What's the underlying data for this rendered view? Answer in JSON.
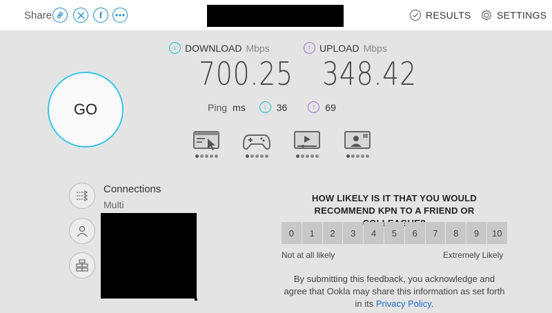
{
  "header": {
    "share_label": "Share",
    "share_buttons": [
      {
        "icon": "link-icon",
        "glyph": "⛓"
      },
      {
        "icon": "x-icon",
        "glyph": "𝕏"
      },
      {
        "icon": "facebook-icon",
        "glyph": "f"
      },
      {
        "icon": "more-icon",
        "glyph": "•••"
      }
    ],
    "results_label": "RESULTS",
    "settings_label": "SETTINGS"
  },
  "test": {
    "go_label": "GO",
    "download": {
      "label": "DOWNLOAD",
      "unit": "Mbps",
      "value": "700.25"
    },
    "upload": {
      "label": "UPLOAD",
      "unit": "Mbps",
      "value": "348.42"
    },
    "ping": {
      "label": "Ping",
      "unit": "ms",
      "download": "36",
      "upload": "69"
    },
    "use_cases": [
      "browsing-icon",
      "gaming-icon",
      "streaming-icon",
      "video-call-icon"
    ]
  },
  "connection": {
    "title": "Connections",
    "mode": "Multi"
  },
  "survey": {
    "question": "HOW LIKELY IS IT THAT YOU WOULD RECOMMEND KPN TO A FRIEND OR COLLEAGUE?",
    "scale": [
      "0",
      "1",
      "2",
      "3",
      "4",
      "5",
      "6",
      "7",
      "8",
      "9",
      "10"
    ],
    "low_label": "Not at all likely",
    "high_label": "Extremely Likely",
    "consent_text": "By submitting this feedback, you acknowledge and agree that Ookla may share this information as set forth in its ",
    "consent_link": "Privacy Policy",
    "consent_end": "."
  },
  "colors": {
    "download": "#1fbfcf",
    "upload": "#a272d6",
    "accent": "#1f8ad1"
  }
}
